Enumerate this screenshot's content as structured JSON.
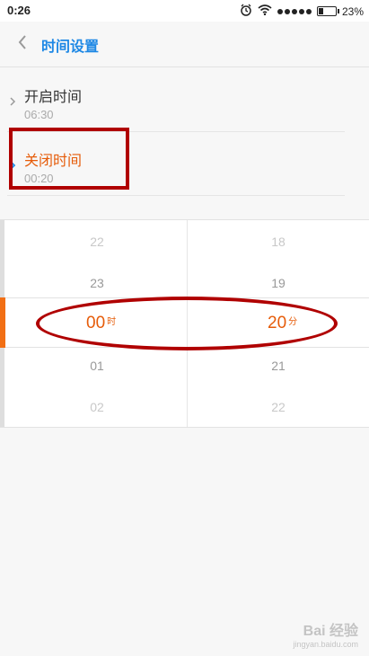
{
  "status_bar": {
    "time": "0:26",
    "battery": "23%",
    "battery_level": 0.23,
    "icons": [
      "alarm-icon",
      "wifi-icon",
      "signal-dots-icon",
      "battery-icon"
    ]
  },
  "header": {
    "back_icon": "chevron-left-icon",
    "title": "时间设置"
  },
  "settings": {
    "open": {
      "label": "开启时间",
      "value": "06:30"
    },
    "close": {
      "label": "关闭时间",
      "value": "00:20"
    }
  },
  "picker": {
    "hours": {
      "above2": "22",
      "above1": "23",
      "selected": "00",
      "unit": "时",
      "below1": "01",
      "below2": "02"
    },
    "minutes": {
      "above2": "18",
      "above1": "19",
      "selected": "20",
      "unit": "分",
      "below1": "21",
      "below2": "22"
    }
  },
  "watermark": {
    "main": "Bai 经验",
    "sub": "jingyan.baidu.com"
  },
  "colors": {
    "accent_blue": "#1e88e5",
    "accent_orange": "#e65c0a",
    "annotation_red": "#b00000"
  }
}
